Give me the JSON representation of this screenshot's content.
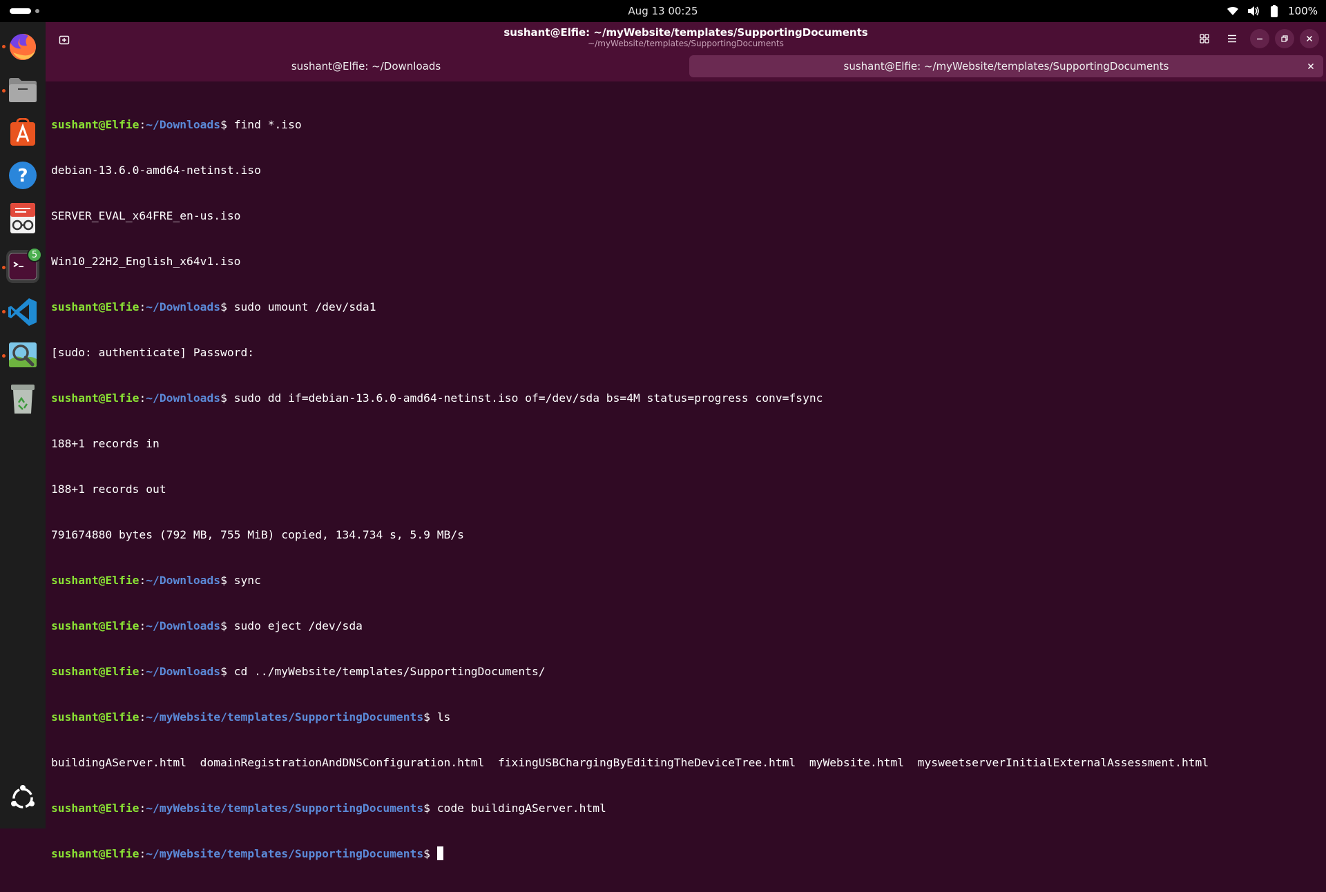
{
  "topbar": {
    "datetime": "Aug 13  00:25",
    "battery_label": "100%",
    "icons": [
      "wifi-icon",
      "volume-icon",
      "battery-icon"
    ]
  },
  "dock": {
    "items": [
      {
        "name": "firefox",
        "running": true
      },
      {
        "name": "files",
        "running": true
      },
      {
        "name": "app-center",
        "running": false
      },
      {
        "name": "help",
        "running": false
      },
      {
        "name": "document-viewer",
        "running": false
      },
      {
        "name": "terminal",
        "running": true,
        "active": true,
        "badge": "5"
      },
      {
        "name": "vscode",
        "running": true
      },
      {
        "name": "image-viewer",
        "running": true
      },
      {
        "name": "trash",
        "running": false
      }
    ]
  },
  "window": {
    "title": "sushant@Elfie: ~/myWebsite/templates/SupportingDocuments",
    "subtitle": "~/myWebsite/templates/SupportingDocuments",
    "tabs": [
      {
        "label": "sushant@Elfie: ~/Downloads",
        "active": false
      },
      {
        "label": "sushant@Elfie: ~/myWebsite/templates/SupportingDocuments",
        "active": true
      }
    ]
  },
  "colors": {
    "terminal_bg": "#300a24",
    "prompt_user": "#8ae234",
    "prompt_path": "#5b8ad8",
    "accent": "#e95420"
  },
  "terminal": {
    "lines": [
      {
        "user": "sushant@Elfie",
        "path": "~/Downloads",
        "cmd": "find *.iso"
      },
      {
        "text": "debian-13.6.0-amd64-netinst.iso"
      },
      {
        "text": "SERVER_EVAL_x64FRE_en-us.iso"
      },
      {
        "text": "Win10_22H2_English_x64v1.iso"
      },
      {
        "user": "sushant@Elfie",
        "path": "~/Downloads",
        "cmd": "sudo umount /dev/sda1"
      },
      {
        "text": "[sudo: authenticate] Password:"
      },
      {
        "user": "sushant@Elfie",
        "path": "~/Downloads",
        "cmd": "sudo dd if=debian-13.6.0-amd64-netinst.iso of=/dev/sda bs=4M status=progress conv=fsync"
      },
      {
        "text": "188+1 records in"
      },
      {
        "text": "188+1 records out"
      },
      {
        "text": "791674880 bytes (792 MB, 755 MiB) copied, 134.734 s, 5.9 MB/s"
      },
      {
        "user": "sushant@Elfie",
        "path": "~/Downloads",
        "cmd": "sync"
      },
      {
        "user": "sushant@Elfie",
        "path": "~/Downloads",
        "cmd": "sudo eject /dev/sda"
      },
      {
        "user": "sushant@Elfie",
        "path": "~/Downloads",
        "cmd": "cd ../myWebsite/templates/SupportingDocuments/"
      },
      {
        "user": "sushant@Elfie",
        "path": "~/myWebsite/templates/SupportingDocuments",
        "cmd": "ls"
      },
      {
        "text": "buildingAServer.html  domainRegistrationAndDNSConfiguration.html  fixingUSBChargingByEditingTheDeviceTree.html  myWebsite.html  mysweetserverInitialExternalAssessment.html"
      },
      {
        "user": "sushant@Elfie",
        "path": "~/myWebsite/templates/SupportingDocuments",
        "cmd": "code buildingAServer.html"
      },
      {
        "user": "sushant@Elfie",
        "path": "~/myWebsite/templates/SupportingDocuments",
        "cmd": "",
        "cursor": true
      }
    ]
  }
}
